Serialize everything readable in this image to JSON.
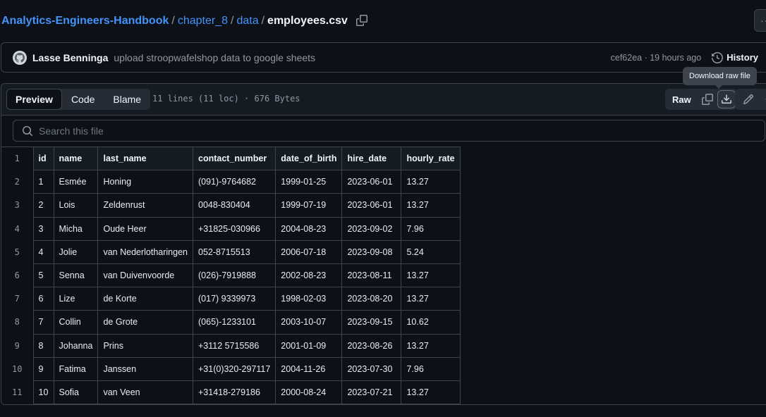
{
  "breadcrumb": {
    "repo": "Analytics-Engineers-Handbook",
    "sep": "/",
    "folder1": "chapter_8",
    "folder2": "data",
    "file": "employees.csv"
  },
  "more_label": "···",
  "commit": {
    "author": "Lasse Benninga",
    "message": "upload stroopwafelshop data to google sheets",
    "sha_time": "cef62ea · 19 hours ago",
    "history_label": "History"
  },
  "file_header": {
    "tabs": [
      "Preview",
      "Code",
      "Blame"
    ],
    "info": "11 lines (11 loc) · 676 Bytes",
    "raw_label": "Raw",
    "tooltip": "Download raw file"
  },
  "search": {
    "placeholder": "Search this file"
  },
  "table": {
    "headers": [
      "id",
      "name",
      "last_name",
      "contact_number",
      "date_of_birth",
      "hire_date",
      "hourly_rate"
    ],
    "rows": [
      [
        "1",
        "Esmée",
        "Honing",
        "(091)-9764682",
        "1999-01-25",
        "2023-06-01",
        "13.27"
      ],
      [
        "2",
        "Lois",
        "Zeldenrust",
        "0048-830404",
        "1999-07-19",
        "2023-06-01",
        "13.27"
      ],
      [
        "3",
        "Micha",
        "Oude Heer",
        "+31825-030966",
        "2004-08-23",
        "2023-09-02",
        "7.96"
      ],
      [
        "4",
        "Jolie",
        "van Nederlotharingen",
        "052-8715513",
        "2006-07-18",
        "2023-09-08",
        "5.24"
      ],
      [
        "5",
        "Senna",
        "van Duivenvoorde",
        "(026)-7919888",
        "2002-08-23",
        "2023-08-11",
        "13.27"
      ],
      [
        "6",
        "Lize",
        "de Korte",
        "(017) 9339973",
        "1998-02-03",
        "2023-08-20",
        "13.27"
      ],
      [
        "7",
        "Collin",
        "de Grote",
        "(065)-1233101",
        "2003-10-07",
        "2023-09-15",
        "10.62"
      ],
      [
        "8",
        "Johanna",
        "Prins",
        "+3112 5715586",
        "2001-01-09",
        "2023-08-26",
        "13.27"
      ],
      [
        "9",
        "Fatima",
        "Janssen",
        "+31(0)320-297117",
        "2004-11-26",
        "2023-07-30",
        "7.96"
      ],
      [
        "10",
        "Sofia",
        "van Veen",
        "+31418-279186",
        "2000-08-24",
        "2023-07-21",
        "13.27"
      ]
    ]
  },
  "colors": {
    "background": "#0d1117",
    "link": "#4493f8",
    "border": "#3d444d",
    "muted": "#9198a1"
  }
}
